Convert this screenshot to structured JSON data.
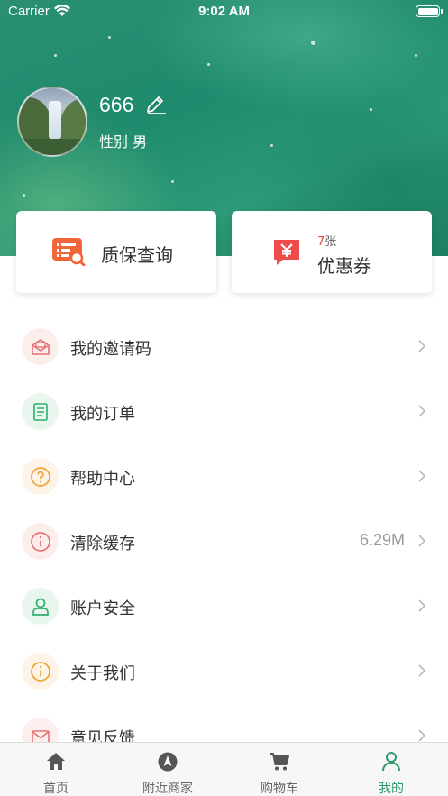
{
  "status_bar": {
    "carrier": "Carrier",
    "time": "9:02 AM"
  },
  "profile": {
    "username": "666",
    "gender": "性别 男"
  },
  "cards": {
    "warranty": {
      "label": "质保查询"
    },
    "coupon": {
      "count_num": "7",
      "count_unit": "张",
      "label": "优惠券"
    }
  },
  "menu": [
    {
      "label": "我的邀请码",
      "icon": "envelope-open-icon",
      "value": ""
    },
    {
      "label": "我的订单",
      "icon": "document-icon",
      "value": ""
    },
    {
      "label": "帮助中心",
      "icon": "question-icon",
      "value": ""
    },
    {
      "label": "清除缓存",
      "icon": "info-icon",
      "value": "6.29M"
    },
    {
      "label": "账户安全",
      "icon": "user-icon",
      "value": ""
    },
    {
      "label": "关于我们",
      "icon": "info-icon",
      "value": ""
    },
    {
      "label": "意见反馈",
      "icon": "mail-icon",
      "value": ""
    }
  ],
  "tabbar": [
    {
      "label": "首页",
      "icon": "home-icon",
      "active": false
    },
    {
      "label": "附近商家",
      "icon": "compass-icon",
      "active": false
    },
    {
      "label": "购物车",
      "icon": "cart-icon",
      "active": false
    },
    {
      "label": "我的",
      "icon": "person-icon",
      "active": true
    }
  ],
  "colors": {
    "accent": "#2e9a6e",
    "coupon_red": "#e74c3c",
    "warranty_orange": "#f0663a"
  }
}
